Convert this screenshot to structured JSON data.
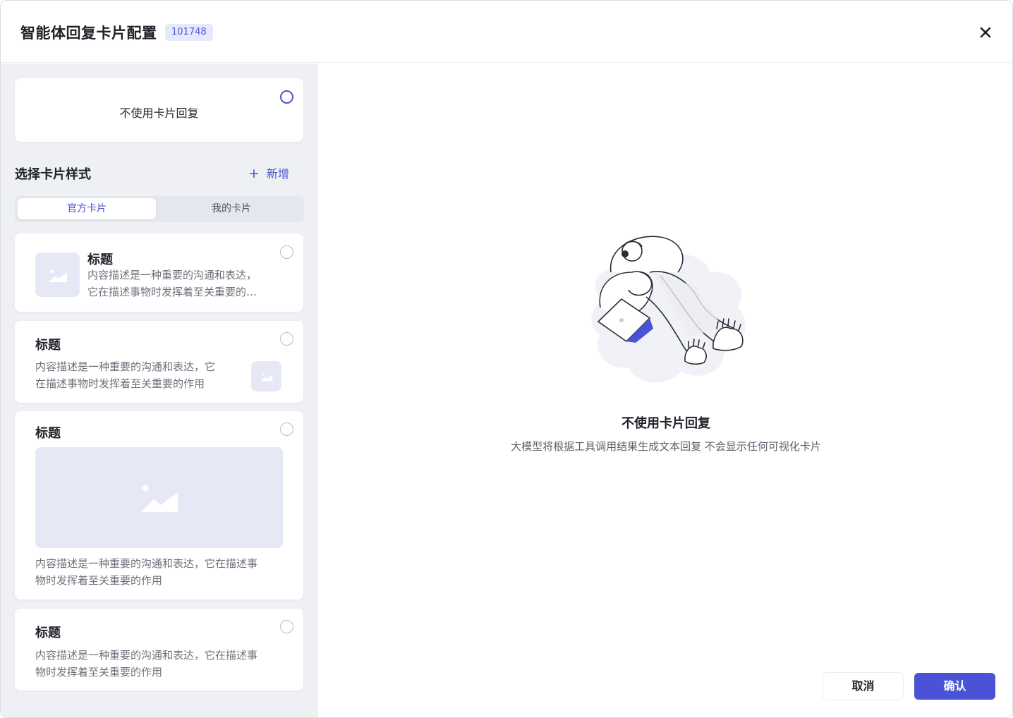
{
  "header": {
    "title": "智能体回复卡片配置",
    "id_badge": "101748",
    "close_icon": "close-icon"
  },
  "no_card_option": {
    "label": "不使用卡片回复",
    "selected": true
  },
  "section": {
    "title": "选择卡片样式",
    "add_label": "新增"
  },
  "tabs": [
    {
      "label": "官方卡片",
      "active": true
    },
    {
      "label": "我的卡片",
      "active": false
    }
  ],
  "cards": [
    {
      "layout": "image-left",
      "title": "标题",
      "desc_lines": [
        "内容描述是一种重要的沟通和表达，",
        "它在描述事物时发挥着至关重要的…"
      ]
    },
    {
      "layout": "image-right",
      "title": "标题",
      "desc_lines": [
        "内容描述是一种重要的沟通和表达，它",
        "在描述事物时发挥着至关重要的作用"
      ]
    },
    {
      "layout": "image-large",
      "title": "标题",
      "desc_lines": [
        "内容描述是一种重要的沟通和表达，它在描述事",
        "物时发挥着至关重要的作用"
      ]
    },
    {
      "layout": "text-only",
      "title": "标题",
      "desc_lines": [
        "内容描述是一种重要的沟通和表达，它在描述事",
        "物时发挥着至关重要的作用"
      ]
    }
  ],
  "preview": {
    "illustration": "person-relaxing-with-laptop-illustration",
    "title": "不使用卡片回复",
    "description": "大模型将根据工具调用结果生成文本回复 不会显示任何可视化卡片"
  },
  "footer": {
    "cancel_label": "取消",
    "confirm_label": "确认"
  },
  "colors": {
    "accent": "#4a52d6",
    "badge_bg": "#e6e8fb",
    "panel_bg": "#eef0f4",
    "placeholder_bg": "#e6e8f5"
  }
}
